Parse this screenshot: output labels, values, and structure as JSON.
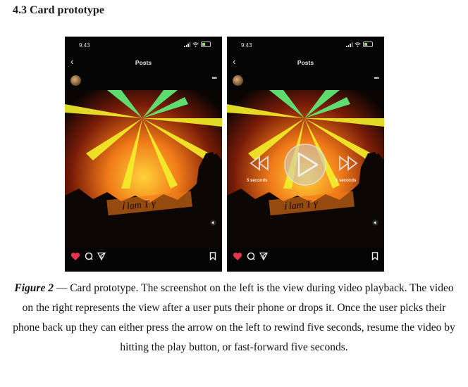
{
  "heading": "4.3 Card prototype",
  "phones": [
    {
      "time": "9:43",
      "title": "Posts",
      "overlay": false
    },
    {
      "time": "9:43",
      "title": "Posts",
      "overlay": true,
      "rewind_label": "5 seconds",
      "forward_label": "5 seconds"
    }
  ],
  "caption": {
    "label": "Figure 2",
    "text": " — Card prototype. The screenshot on the left is the view during video playback. The video on the right represents the view after a user puts their phone or drops it. Once the user picks their phone back up they can either press the arrow on the left to rewind five seconds, resume the video by hitting the play button, or fast-forward five seconds."
  },
  "colors": {
    "heart": "#e8344a",
    "laser_green": "#5ff27a",
    "laser_yellow": "#f4f02a",
    "stage_orange": "#f07a18"
  },
  "icons": [
    "back-chevron-icon",
    "more-icon",
    "heart-icon",
    "comment-icon",
    "share-icon",
    "bookmark-icon",
    "volume-icon",
    "rewind-icon",
    "play-icon",
    "fast-forward-icon"
  ]
}
